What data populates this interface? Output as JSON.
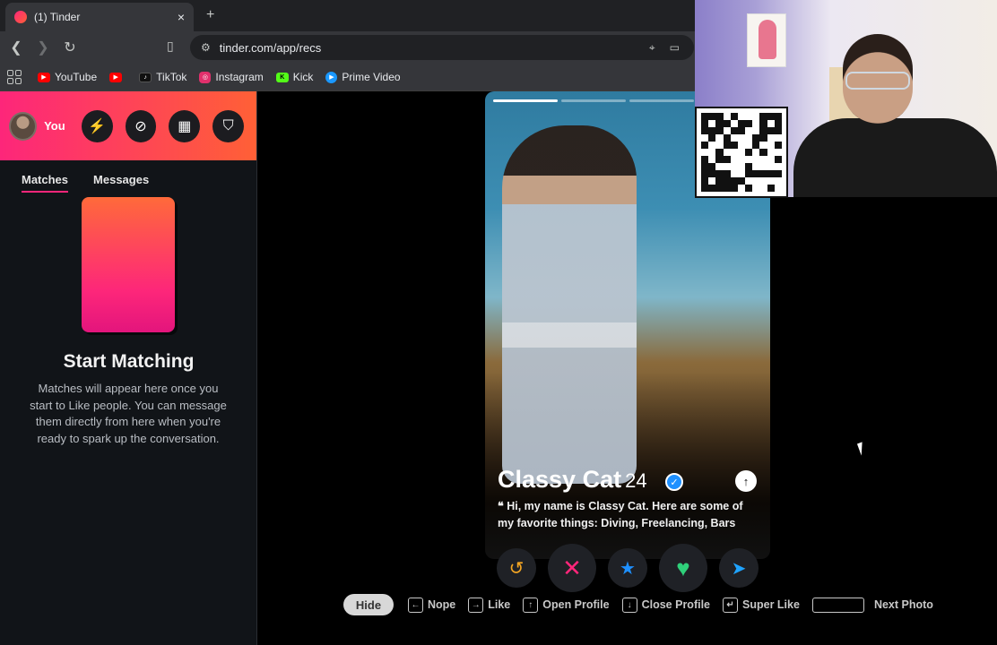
{
  "browser": {
    "tab_title": "(1) Tinder",
    "tab_close": "×",
    "new_tab": "+",
    "url": "tinder.com/app/recs",
    "bookmarks": [
      {
        "label": "YouTube",
        "color": "#ff0000"
      },
      {
        "label": "",
        "color": "#ff0000"
      },
      {
        "label": "TikTok",
        "color": "#111111"
      },
      {
        "label": "Instagram",
        "color": "#e1306c"
      },
      {
        "label": "Kick",
        "color": "#53fc18"
      },
      {
        "label": "Prime Video",
        "color": "#1a98ff"
      }
    ]
  },
  "sidebar": {
    "profile_label": "You",
    "tabs": [
      {
        "label": "Matches",
        "active": true
      },
      {
        "label": "Messages",
        "active": false
      }
    ],
    "empty_title": "Start Matching",
    "empty_desc": "Matches will appear here once you start to Like people. You can message them directly from here when you're ready to spark up the conversation."
  },
  "profile": {
    "name": "Classy Cat",
    "age": "24",
    "bio_quote": "❝",
    "bio": "Hi, my name is Classy Cat. Here are some of my favorite things: Diving, Freelancing, Bars",
    "photo_count": 4,
    "active_photo": 1
  },
  "actions": {
    "rewind": "↺",
    "nope": "✕",
    "superlike": "★",
    "like": "♥",
    "boost": "➤"
  },
  "shortcuts": {
    "hide": "Hide",
    "items": [
      {
        "key": "←",
        "label": "Nope"
      },
      {
        "key": "→",
        "label": "Like"
      },
      {
        "key": "↑",
        "label": "Open Profile"
      },
      {
        "key": "↓",
        "label": "Close Profile"
      },
      {
        "key": "↵",
        "label": "Super Like"
      },
      {
        "key": "",
        "label": "Next Photo"
      }
    ]
  },
  "colors": {
    "brand_start": "#fd267a",
    "brand_end": "#ff6036",
    "like": "#2fd07a",
    "nope": "#fd267a",
    "superlike": "#1e90ff",
    "rewind": "#f5a623",
    "boost": "#1fa3ff"
  }
}
